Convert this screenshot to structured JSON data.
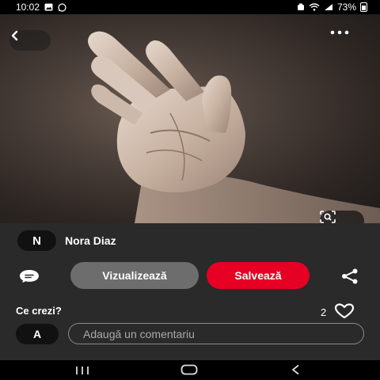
{
  "status_bar": {
    "time": "10:02",
    "battery": "73%"
  },
  "pin": {
    "author_initial": "N",
    "author_name": "Nora Diaz"
  },
  "actions": {
    "view_label": "Vizualizează",
    "save_label": "Salvează"
  },
  "comments": {
    "title": "Ce crezi?",
    "likes_count": "2",
    "user_initial": "A",
    "input_placeholder": "Adaugă un comentariu"
  },
  "colors": {
    "save": "#e60023",
    "view": "#6d6d6d",
    "panel": "#2a2a2a"
  },
  "icons": [
    "back-icon",
    "more-icon",
    "visual-search-icon",
    "comment-icon",
    "share-icon",
    "heart-icon"
  ]
}
